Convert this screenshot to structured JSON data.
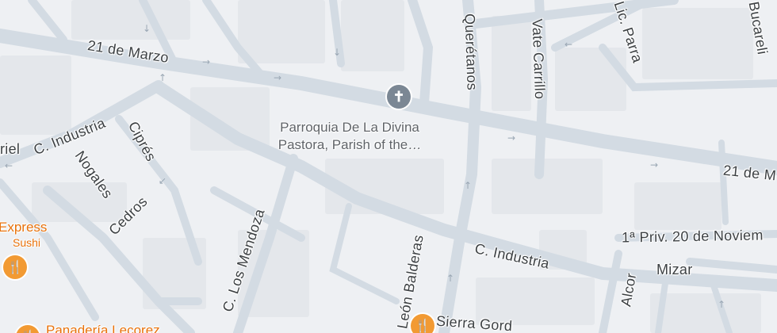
{
  "map": {
    "streets": [
      "21 de Marzo",
      "21 de M",
      "C. Industria",
      "C. Industria",
      "Querétanos",
      "Vate Carrillo",
      "Lic. Parra",
      "Bucareli",
      "Ciprés",
      "Nogales",
      "Cedros",
      "C. Los Mendoza",
      "León Balderas",
      "1ª Priv. 20 de Noviem",
      "Mizar",
      "Alcor",
      "Sierra Gord",
      "riel"
    ],
    "places": [
      {
        "name_line1": "Parroquia De La Divina",
        "name_line2": "Pastora, Parish of the…",
        "icon": "church-icon"
      },
      {
        "name_line1": "Express",
        "name_line2": "Sushi",
        "icon": "restaurant-icon"
      },
      {
        "name_line1": "Panadería Lecorez",
        "name_line2": "",
        "icon": "restaurant-icon"
      },
      {
        "name_line1": "",
        "name_line2": "",
        "icon": "restaurant-icon"
      }
    ],
    "colors": {
      "background": "#eef0f3",
      "road": "#d6dee6",
      "block": "#e2e5e9",
      "poi_label": "#e8710a",
      "church_pin": "#7b8794",
      "food_pin": "#f29a33"
    }
  }
}
